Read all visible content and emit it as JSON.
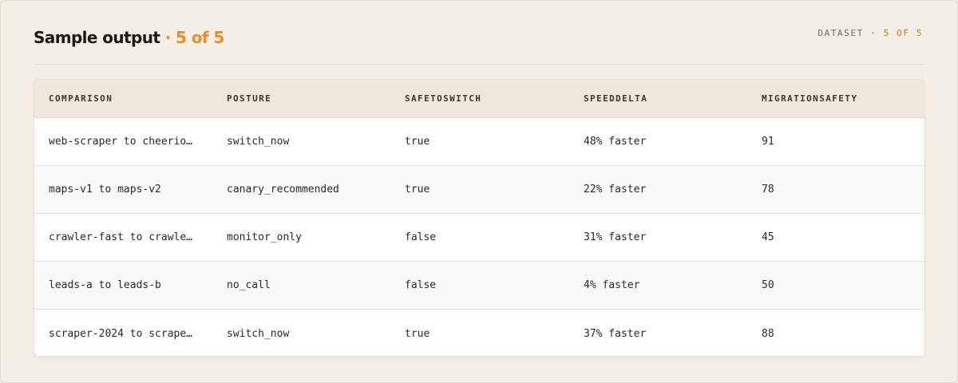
{
  "header": {
    "title": "Sample output",
    "separator": "·",
    "count": "5 of 5",
    "dataset_label": "DATASET",
    "dataset_separator": "·",
    "dataset_count": "5 OF 5"
  },
  "table": {
    "columns": [
      "COMPARISON",
      "POSTURE",
      "SAFETOSWITCH",
      "SPEEDDELTA",
      "MIGRATIONSAFETY"
    ],
    "rows": [
      [
        "web-scraper to cheerio…",
        "switch_now",
        "true",
        "48% faster",
        "91"
      ],
      [
        "maps-v1 to maps-v2",
        "canary_recommended",
        "true",
        "22% faster",
        "78"
      ],
      [
        "crawler-fast to crawle…",
        "monitor_only",
        "false",
        "31% faster",
        "45"
      ],
      [
        "leads-a to leads-b",
        "no_call",
        "false",
        "4% faster",
        "50"
      ],
      [
        "scraper-2024 to scrape…",
        "switch_now",
        "true",
        "37% faster",
        "88"
      ]
    ]
  }
}
